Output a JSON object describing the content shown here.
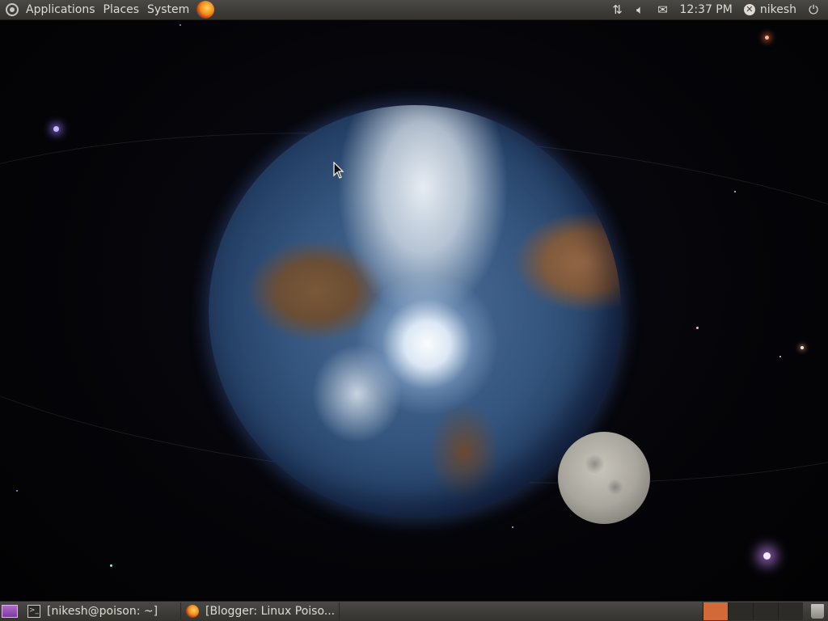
{
  "top_panel": {
    "menus": [
      {
        "label": "Applications"
      },
      {
        "label": "Places"
      },
      {
        "label": "System"
      }
    ],
    "launcher_icon": "firefox-icon",
    "tray": {
      "network_icon": "network-arrows-icon",
      "volume_icon": "volume-icon",
      "mail_icon": "envelope-icon",
      "clock": "12:37 PM",
      "user_name": "nikesh",
      "power_icon": "power-icon"
    }
  },
  "bottom_panel": {
    "show_desktop_icon": "show-desktop-icon",
    "tasks": [
      {
        "label": "[nikesh@poison: ~]",
        "icon": "terminal-icon"
      },
      {
        "label": "[Blogger: Linux Poiso...",
        "icon": "firefox-icon"
      }
    ],
    "workspaces": {
      "count": 4,
      "active_index": 0,
      "active_color": "#d26a38"
    },
    "trash_icon": "trash-icon"
  },
  "wallpaper": {
    "subject": "earth-and-moon-in-space",
    "accent_colors": {
      "space": "#050509",
      "earth_glow": "#466ebe",
      "panel": "#3c3b37"
    }
  }
}
